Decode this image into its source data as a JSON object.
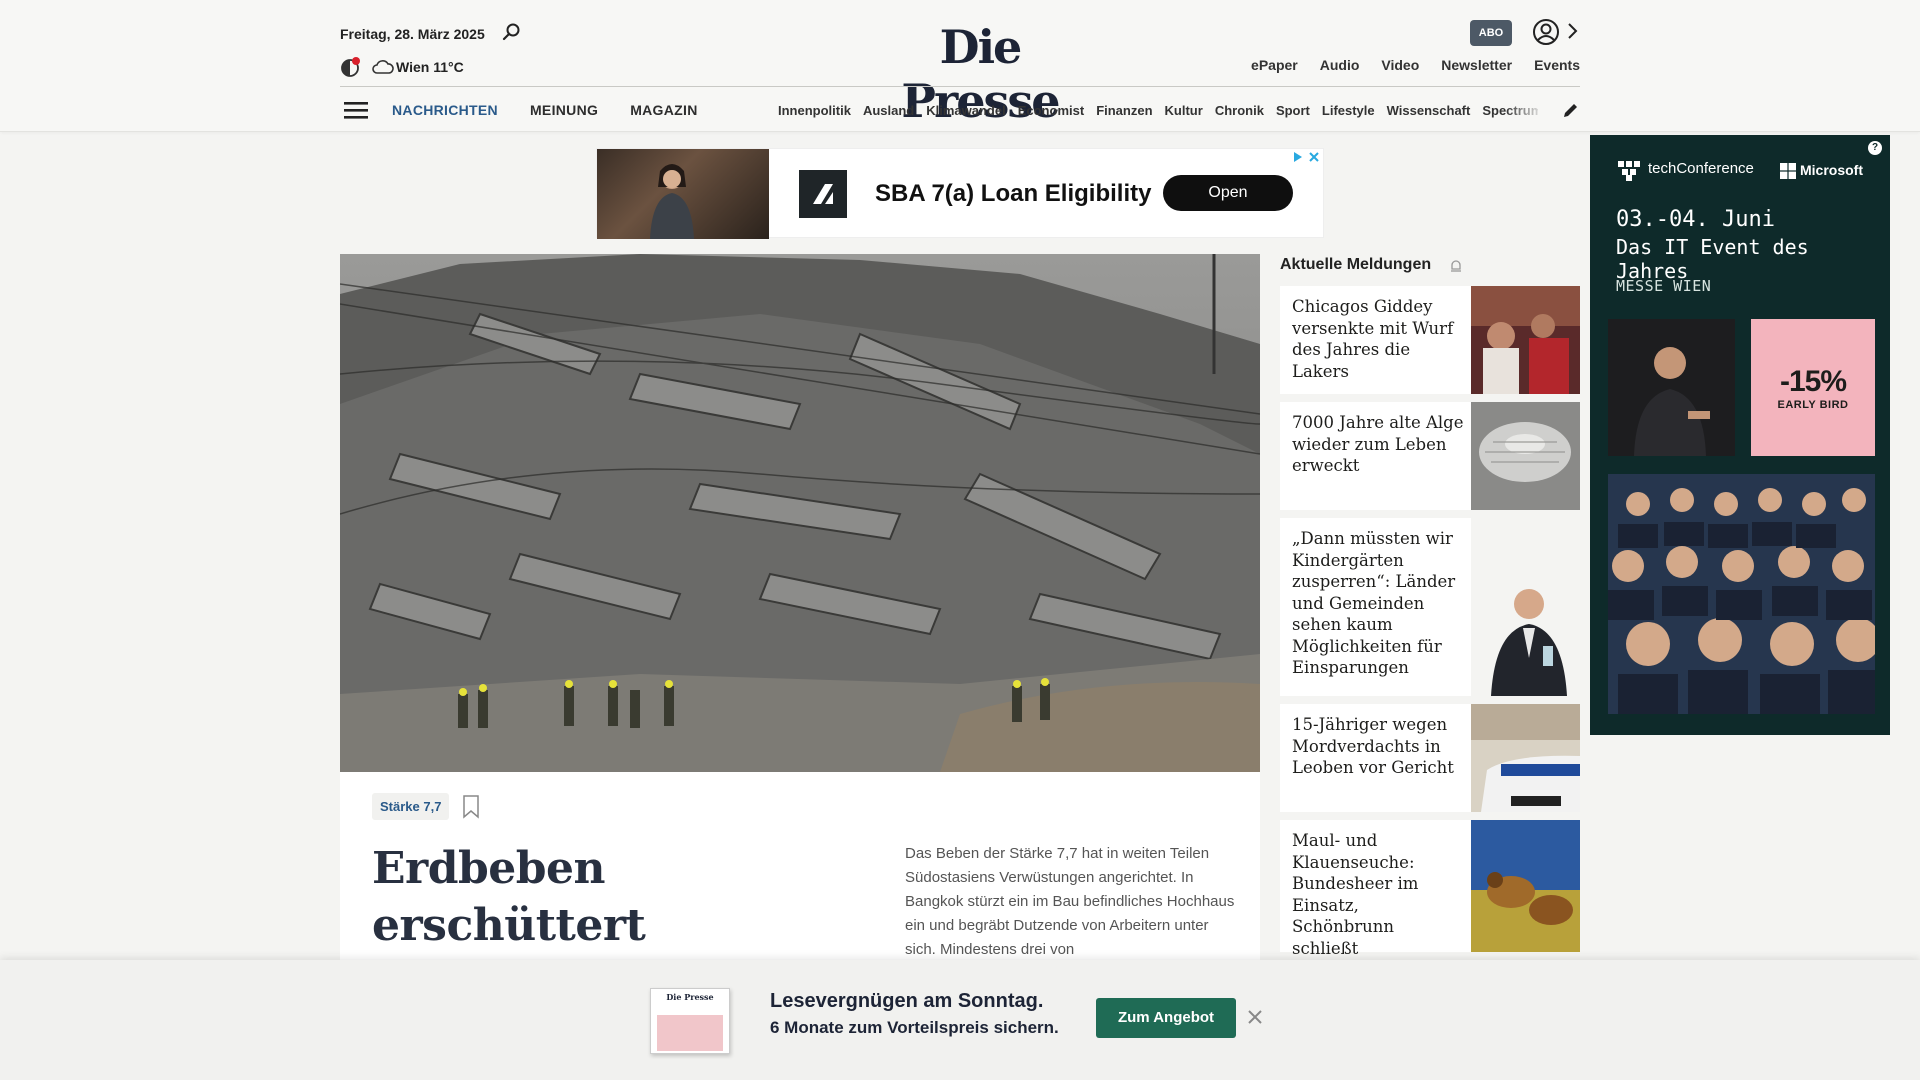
{
  "header": {
    "date": "Freitag, 28. März 2025",
    "weather": "Wien 11°C",
    "logo": "Die Presse",
    "abo_label": "ABO",
    "top_links": [
      "ePaper",
      "Audio",
      "Video",
      "Newsletter",
      "Events"
    ],
    "main_nav": [
      "NACHRICHTEN",
      "MEINUNG",
      "MAGAZIN"
    ],
    "sub_nav": [
      "Innenpolitik",
      "Ausland",
      "Klimawandel",
      "Economist",
      "Finanzen",
      "Kultur",
      "Chronik",
      "Sport",
      "Lifestyle",
      "Wissenschaft",
      "Spectrum"
    ]
  },
  "top_ad": {
    "text": "SBA 7(a) Loan Eligibility",
    "button": "Open"
  },
  "hero": {
    "tag": "Stärke 7,7",
    "headline": "Erdbeben erschüttert Thailand und Burma:",
    "teaser": "Das Beben der Stärke 7,7 hat in weiten Teilen Südostasiens Verwüstungen angerichtet. In Bangkok stürzt ein im Bau befindliches Hochhaus ein und begräbt Dutzende von Arbeitern unter sich. Mindestens drei von"
  },
  "news": {
    "heading": "Aktuelle Meldungen",
    "items": [
      {
        "title": "Chicagos Giddey versenkte mit Wurf des Jahres die Lakers"
      },
      {
        "title": "7000 Jahre alte Alge wieder zum Leben erweckt"
      },
      {
        "title": "„Dann müssten wir Kindergärten zusperren“: Länder und Gemeinden sehen kaum Möglichkeiten für Einsparungen"
      },
      {
        "title": "15-Jähriger wegen Mordverdachts in Leoben vor Gericht"
      },
      {
        "title": "Maul- und Klauenseuche: Bundesheer im Einsatz, Schönbrunn schließt Streichelzoo"
      }
    ]
  },
  "side_ad": {
    "brand": "techConference",
    "partner": "Microsoft",
    "date": "03.-04. Juni",
    "subtitle": "Das IT Event des Jahres",
    "location": "MESSE WIEN",
    "promo_pct": "-15%",
    "promo_label": "EARLY BIRD",
    "help": "?"
  },
  "bottom_banner": {
    "title": "Lesevergnügen am Sonntag.",
    "subtitle": "6 Monate zum Vorteilspreis sichern.",
    "button": "Zum Angebot",
    "paper_mini": "Die Presse"
  },
  "colors": {
    "accent": "#2a5a8a",
    "cta_green": "#1f6b55",
    "ad_dark": "#0e2a2a",
    "promo_pink": "#f3b4bd"
  }
}
